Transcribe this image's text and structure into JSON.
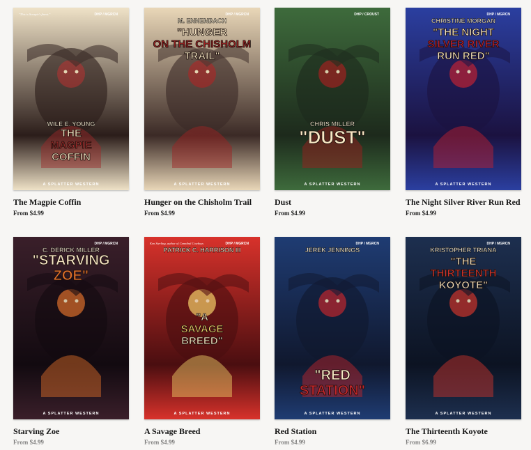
{
  "products": [
    {
      "title": "The Magpie Coffin",
      "price": "From $4.99",
      "cover": {
        "author": "WILE E. YOUNG",
        "title_lines": [
          "THE",
          "MAGPIE",
          "COFFIN"
        ],
        "series": "A SPLATTER WESTERN",
        "publisher": "DHP / MGRCN",
        "blurb": "\"This is Scrapie's finest.\""
      },
      "palette": {
        "bg": "#efe2c7",
        "accent": "#9c2a2a",
        "dark": "#2b1d1a"
      }
    },
    {
      "title": "Hunger on the Chisholm Trail",
      "price": "From $4.99",
      "cover": {
        "author": "M. ENNENBACH",
        "title_lines": [
          "\"HUNGER",
          "ON THE CHISHOLM",
          "TRAIL\""
        ],
        "series": "A SPLATTER WESTERN",
        "publisher": "DHP / MGRCN",
        "blurb": ""
      },
      "palette": {
        "bg": "#e9d7b8",
        "accent": "#9e2222",
        "dark": "#3b2a26"
      }
    },
    {
      "title": "Dust",
      "price": "From $4.99",
      "cover": {
        "author": "CHRIS MILLER",
        "title_lines": [
          "\"DUST\""
        ],
        "series": "A SPLATTER WESTERN",
        "publisher": "DHP / CROUST",
        "blurb": ""
      },
      "palette": {
        "bg": "#3e6b3c",
        "accent": "#a11e1e",
        "dark": "#1d2a1c"
      }
    },
    {
      "title": "The Night Silver River Run Red",
      "price": "From $4.99",
      "cover": {
        "author": "CHRISTINE MORGAN",
        "title_lines": [
          "\"THE NIGHT",
          "SILVER RIVER",
          "RUN RED\""
        ],
        "series": "A SPLATTER WESTERN",
        "publisher": "DHP / MGRCN",
        "blurb": ""
      },
      "palette": {
        "bg": "#2b3fa0",
        "accent": "#c2202f",
        "dark": "#1b1240"
      }
    },
    {
      "title": "Starving Zoe",
      "price": "From $4.99",
      "cover": {
        "author": "C. DERICK MILLER",
        "title_lines": [
          "\"STARVING",
          "ZOE\""
        ],
        "series": "A SPLATTER WESTERN",
        "publisher": "DHP / MGRCN",
        "blurb": ""
      },
      "palette": {
        "bg": "#3a1f2a",
        "accent": "#e0702a",
        "dark": "#120a10"
      }
    },
    {
      "title": "A Savage Breed",
      "price": "From $4.99",
      "cover": {
        "author": "PATRICK C. HARRISON III",
        "title_lines": [
          "\"A",
          "SAVAGE",
          "BREED\""
        ],
        "series": "A SPLATTER WESTERN",
        "publisher": "DHP / MGRCN",
        "blurb": "Ken Sterling, author of Cannibal Cowboys"
      },
      "palette": {
        "bg": "#d8322b",
        "accent": "#f3d36a",
        "dark": "#4a0e10"
      }
    },
    {
      "title": "Red Station",
      "price": "From $4.99",
      "cover": {
        "author": "JEREK JENNINGS",
        "title_lines": [
          "\"RED",
          "STATION\""
        ],
        "series": "A SPLATTER WESTERN",
        "publisher": "DHP / MGRCN",
        "blurb": ""
      },
      "palette": {
        "bg": "#1f3c73",
        "accent": "#c3262b",
        "dark": "#10182e"
      }
    },
    {
      "title": "The Thirteenth Koyote",
      "price": "From $6.99",
      "cover": {
        "author": "KRISTOPHER TRIANA",
        "title_lines": [
          "\"THE",
          "THIRTEENTH",
          "KOYOTE\""
        ],
        "series": "A SPLATTER WESTERN",
        "publisher": "DHP / MGRCN",
        "blurb": ""
      },
      "palette": {
        "bg": "#1d2f4f",
        "accent": "#d1342b",
        "dark": "#0c1322"
      }
    }
  ]
}
